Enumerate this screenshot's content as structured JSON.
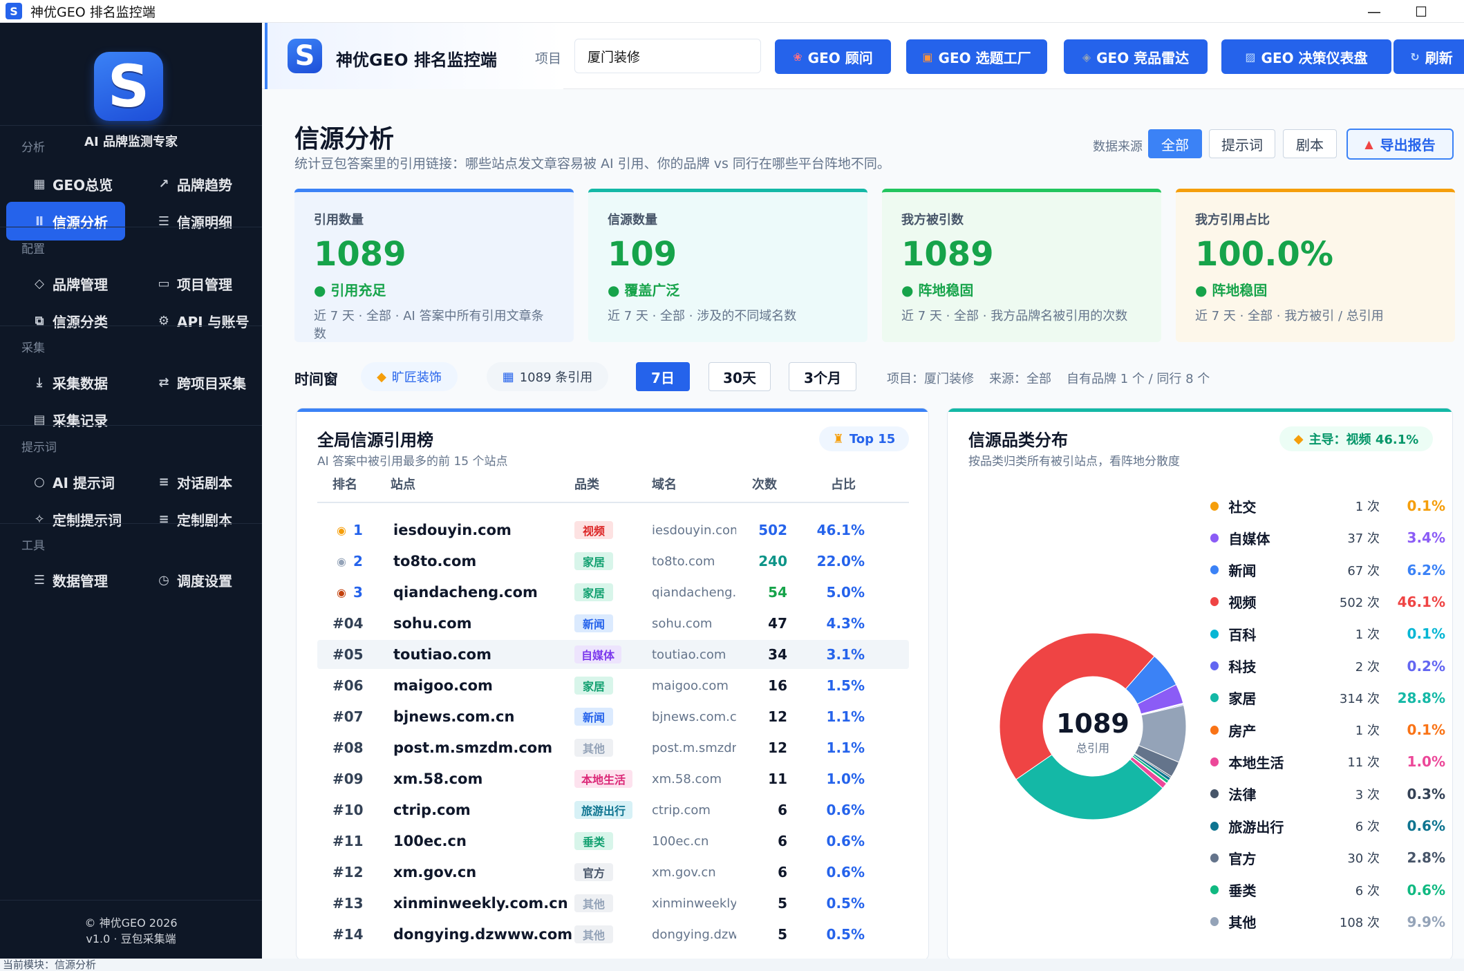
{
  "window": {
    "title": "神优GEO 排名监控端",
    "app_icon_letter": "S"
  },
  "sidebar": {
    "logo_letter": "S",
    "brand_subtitle": "AI 品牌监测专家",
    "sections": [
      {
        "title": "分析",
        "items": [
          {
            "label": "GEO总览",
            "icon": "grid-icon"
          },
          {
            "label": "品牌趋势",
            "icon": "trend-icon"
          },
          {
            "label": "信源分析",
            "icon": "bars-icon",
            "active": true
          },
          {
            "label": "信源明细",
            "icon": "list-icon"
          }
        ]
      },
      {
        "title": "配置",
        "items": [
          {
            "label": "品牌管理",
            "icon": "tag-icon"
          },
          {
            "label": "项目管理",
            "icon": "folder-icon"
          },
          {
            "label": "信源分类",
            "icon": "copy-icon"
          },
          {
            "label": "API 与账号",
            "icon": "gear-icon"
          }
        ]
      },
      {
        "title": "采集",
        "items": [
          {
            "label": "采集数据",
            "icon": "download-icon"
          },
          {
            "label": "跨项目采集",
            "icon": "swap-icon"
          },
          {
            "label": "采集记录",
            "icon": "document-icon"
          }
        ]
      },
      {
        "title": "提示词",
        "items": [
          {
            "label": "AI 提示词",
            "icon": "chat-icon"
          },
          {
            "label": "对话剧本",
            "icon": "script-icon"
          },
          {
            "label": "定制提示词",
            "icon": "sparkle-icon"
          },
          {
            "label": "定制剧本",
            "icon": "script-icon"
          }
        ]
      },
      {
        "title": "工具",
        "items": [
          {
            "label": "数据管理",
            "icon": "database-icon"
          },
          {
            "label": "调度设置",
            "icon": "clock-icon"
          }
        ]
      }
    ],
    "footer_copyright": "© 神优GEO 2026",
    "footer_version": "v1.0 · 豆包采集端"
  },
  "toolbar": {
    "logo_letter": "S",
    "title": "神优GEO 排名监控端",
    "project_label": "项目",
    "project_value": "厦门装修",
    "buttons": [
      {
        "label": "GEO 顾问",
        "icon": "brain-icon"
      },
      {
        "label": "GEO 选题工厂",
        "icon": "doc-icon"
      },
      {
        "label": "GEO 竞品雷达",
        "icon": "radar-icon"
      },
      {
        "label": "GEO 决策仪表盘",
        "icon": "chart-icon"
      },
      {
        "label": "刷新",
        "icon": "refresh-icon"
      }
    ]
  },
  "page": {
    "title": "信源分析",
    "subtitle": "统计豆包答案里的引用链接：哪些站点发文章容易被 AI 引用、你的品牌 vs 同行在哪些平台阵地不同。",
    "source_label": "数据来源",
    "source_options": [
      "全部",
      "提示词",
      "剧本"
    ],
    "source_selected": "全部",
    "export_label": "导出报告"
  },
  "kpis": [
    {
      "label": "引用数量",
      "value": "1089",
      "status": "● 引用充足",
      "desc": "近 7 天 · 全部 · AI 答案中所有引用文章条数",
      "color": "#16a34a",
      "accent": "#3b82f6",
      "bg": "#eef4fd"
    },
    {
      "label": "信源数量",
      "value": "109",
      "status": "● 覆盖广泛",
      "desc": "近 7 天 · 全部 · 涉及的不同域名数",
      "color": "#16a34a",
      "accent": "#14b8a6",
      "bg": "#edfafa"
    },
    {
      "label": "我方被引数",
      "value": "1089",
      "status": "● 阵地稳固",
      "desc": "近 7 天 · 全部 · 我方品牌名被引用的次数",
      "color": "#16a34a",
      "accent": "#22c55e",
      "bg": "#eefaf1"
    },
    {
      "label": "我方引用占比",
      "value": "100.0%",
      "status": "● 阵地稳固",
      "desc": "近 7 天 · 全部 · 我方被引 / 总引用",
      "color": "#16a34a",
      "accent": "#f59e0b",
      "bg": "#fdf7ea"
    }
  ],
  "time_window": {
    "label": "时间窗",
    "brand_chip": "旷匠装饰",
    "count_chip": "1089 条引用",
    "ranges": [
      "7日",
      "30天",
      "3个月"
    ],
    "selected": "7日",
    "meta_project": "项目：厦门装修",
    "meta_source": "来源：全部",
    "meta_brands": "自有品牌 1 个 / 同行 8 个"
  },
  "leaderboard": {
    "title": "全局信源引用榜",
    "subtitle": "AI 答案中被引用最多的前 15 个站点",
    "badge": "Top 15",
    "headers": {
      "rank": "排名",
      "site": "站点",
      "category": "品类",
      "domain": "域名",
      "count": "次数",
      "pct": "占比"
    },
    "rows": [
      {
        "rank": "1",
        "medal": "gold-medal-icon",
        "site": "iesdouyin.com",
        "category": "视频",
        "domain": "iesdouyin.com",
        "count": "502",
        "pct": "46.1%",
        "tag_bg": "#fde2e2",
        "tag_fg": "#dc2626",
        "count_color": "#2563eb"
      },
      {
        "rank": "2",
        "medal": "silver-medal-icon",
        "site": "to8to.com",
        "category": "家居",
        "domain": "to8to.com",
        "count": "240",
        "pct": "22.0%",
        "tag_bg": "#d8f5ea",
        "tag_fg": "#0f9f6e",
        "count_color": "#0d9488"
      },
      {
        "rank": "3",
        "medal": "bronze-medal-icon",
        "site": "qiandacheng.com",
        "category": "家居",
        "domain": "qiandacheng.cc",
        "count": "54",
        "pct": "5.0%",
        "tag_bg": "#d8f5ea",
        "tag_fg": "#0f9f6e",
        "count_color": "#16a34a"
      },
      {
        "rank": "#04",
        "site": "sohu.com",
        "category": "新闻",
        "domain": "sohu.com",
        "count": "47",
        "pct": "4.3%",
        "tag_bg": "#dbeafe",
        "tag_fg": "#2563eb",
        "count_color": "#0f172a"
      },
      {
        "rank": "#05",
        "site": "toutiao.com",
        "category": "自媒体",
        "domain": "toutiao.com",
        "count": "34",
        "pct": "3.1%",
        "tag_bg": "#ede4fd",
        "tag_fg": "#7c3aed",
        "count_color": "#0f172a",
        "highlight": true
      },
      {
        "rank": "#06",
        "site": "maigoo.com",
        "category": "家居",
        "domain": "maigoo.com",
        "count": "16",
        "pct": "1.5%",
        "tag_bg": "#d8f5ea",
        "tag_fg": "#0f9f6e",
        "count_color": "#0f172a"
      },
      {
        "rank": "#07",
        "site": "bjnews.com.cn",
        "category": "新闻",
        "domain": "bjnews.com.cn",
        "count": "12",
        "pct": "1.1%",
        "tag_bg": "#dbeafe",
        "tag_fg": "#2563eb",
        "count_color": "#0f172a"
      },
      {
        "rank": "#08",
        "site": "post.m.smzdm.com",
        "category": "其他",
        "domain": "post.m.smzdm.",
        "count": "12",
        "pct": "1.1%",
        "tag_bg": "#eef0f3",
        "tag_fg": "#94a3b8",
        "count_color": "#0f172a"
      },
      {
        "rank": "#09",
        "site": "xm.58.com",
        "category": "本地生活",
        "domain": "xm.58.com",
        "count": "11",
        "pct": "1.0%",
        "tag_bg": "#fde2ee",
        "tag_fg": "#db2777",
        "count_color": "#0f172a"
      },
      {
        "rank": "#10",
        "site": "ctrip.com",
        "category": "旅游出行",
        "domain": "ctrip.com",
        "count": "6",
        "pct": "0.6%",
        "tag_bg": "#d7f1f6",
        "tag_fg": "#0e7490",
        "count_color": "#0f172a"
      },
      {
        "rank": "#11",
        "site": "100ec.cn",
        "category": "垂类",
        "domain": "100ec.cn",
        "count": "6",
        "pct": "0.6%",
        "tag_bg": "#d8f5ea",
        "tag_fg": "#0f9f6e",
        "count_color": "#0f172a"
      },
      {
        "rank": "#12",
        "site": "xm.gov.cn",
        "category": "官方",
        "domain": "xm.gov.cn",
        "count": "6",
        "pct": "0.6%",
        "tag_bg": "#eef0f3",
        "tag_fg": "#475569",
        "count_color": "#0f172a"
      },
      {
        "rank": "#13",
        "site": "xinminweekly.com.cn",
        "category": "其他",
        "domain": "xinminweekly.c",
        "count": "5",
        "pct": "0.5%",
        "tag_bg": "#eef0f3",
        "tag_fg": "#94a3b8",
        "count_color": "#0f172a"
      },
      {
        "rank": "#14",
        "site": "dongying.dzwww.com",
        "category": "其他",
        "domain": "dongying.dzww",
        "count": "5",
        "pct": "0.5%",
        "tag_bg": "#eef0f3",
        "tag_fg": "#94a3b8",
        "count_color": "#0f172a"
      }
    ]
  },
  "category_panel": {
    "title": "信源品类分布",
    "subtitle": "按品类归类所有被引站点，看阵地分散度",
    "badge": "主导：视频 46.1%",
    "center_value": "1089",
    "center_label": "总引用"
  },
  "chart_data": {
    "type": "pie",
    "title": "信源品类分布",
    "total": 1089,
    "series": [
      {
        "name": "社交",
        "count": "1 次",
        "pct": "0.1%",
        "value": 1,
        "color": "#f59e0b"
      },
      {
        "name": "自媒体",
        "count": "37 次",
        "pct": "3.4%",
        "value": 37,
        "color": "#8b5cf6"
      },
      {
        "name": "新闻",
        "count": "67 次",
        "pct": "6.2%",
        "value": 67,
        "color": "#3b82f6"
      },
      {
        "name": "视频",
        "count": "502 次",
        "pct": "46.1%",
        "value": 502,
        "color": "#ef4444"
      },
      {
        "name": "百科",
        "count": "1 次",
        "pct": "0.1%",
        "value": 1,
        "color": "#06b6d4"
      },
      {
        "name": "科技",
        "count": "2 次",
        "pct": "0.2%",
        "value": 2,
        "color": "#6366f1"
      },
      {
        "name": "家居",
        "count": "314 次",
        "pct": "28.8%",
        "value": 314,
        "color": "#14b8a6"
      },
      {
        "name": "房产",
        "count": "1 次",
        "pct": "0.1%",
        "value": 1,
        "color": "#f97316"
      },
      {
        "name": "本地生活",
        "count": "11 次",
        "pct": "1.0%",
        "value": 11,
        "color": "#ec4899"
      },
      {
        "name": "法律",
        "count": "3 次",
        "pct": "0.3%",
        "value": 3,
        "color": "#475569"
      },
      {
        "name": "旅游出行",
        "count": "6 次",
        "pct": "0.6%",
        "value": 6,
        "color": "#0e7490"
      },
      {
        "name": "官方",
        "count": "30 次",
        "pct": "2.8%",
        "value": 30,
        "color": "#64748b"
      },
      {
        "name": "垂类",
        "count": "6 次",
        "pct": "0.6%",
        "value": 6,
        "color": "#10b981"
      },
      {
        "name": "其他",
        "count": "108 次",
        "pct": "9.9%",
        "value": 108,
        "color": "#94a3b8"
      }
    ],
    "pct_colors": [
      "#f59e0b",
      "#8b5cf6",
      "#3b82f6",
      "#ef4444",
      "#06b6d4",
      "#6366f1",
      "#14b8a6",
      "#f97316",
      "#ec4899",
      "#334155",
      "#0e7490",
      "#475569",
      "#10b981",
      "#94a3b8"
    ]
  },
  "statusbar": {
    "text": "当前模块：信源分析"
  }
}
